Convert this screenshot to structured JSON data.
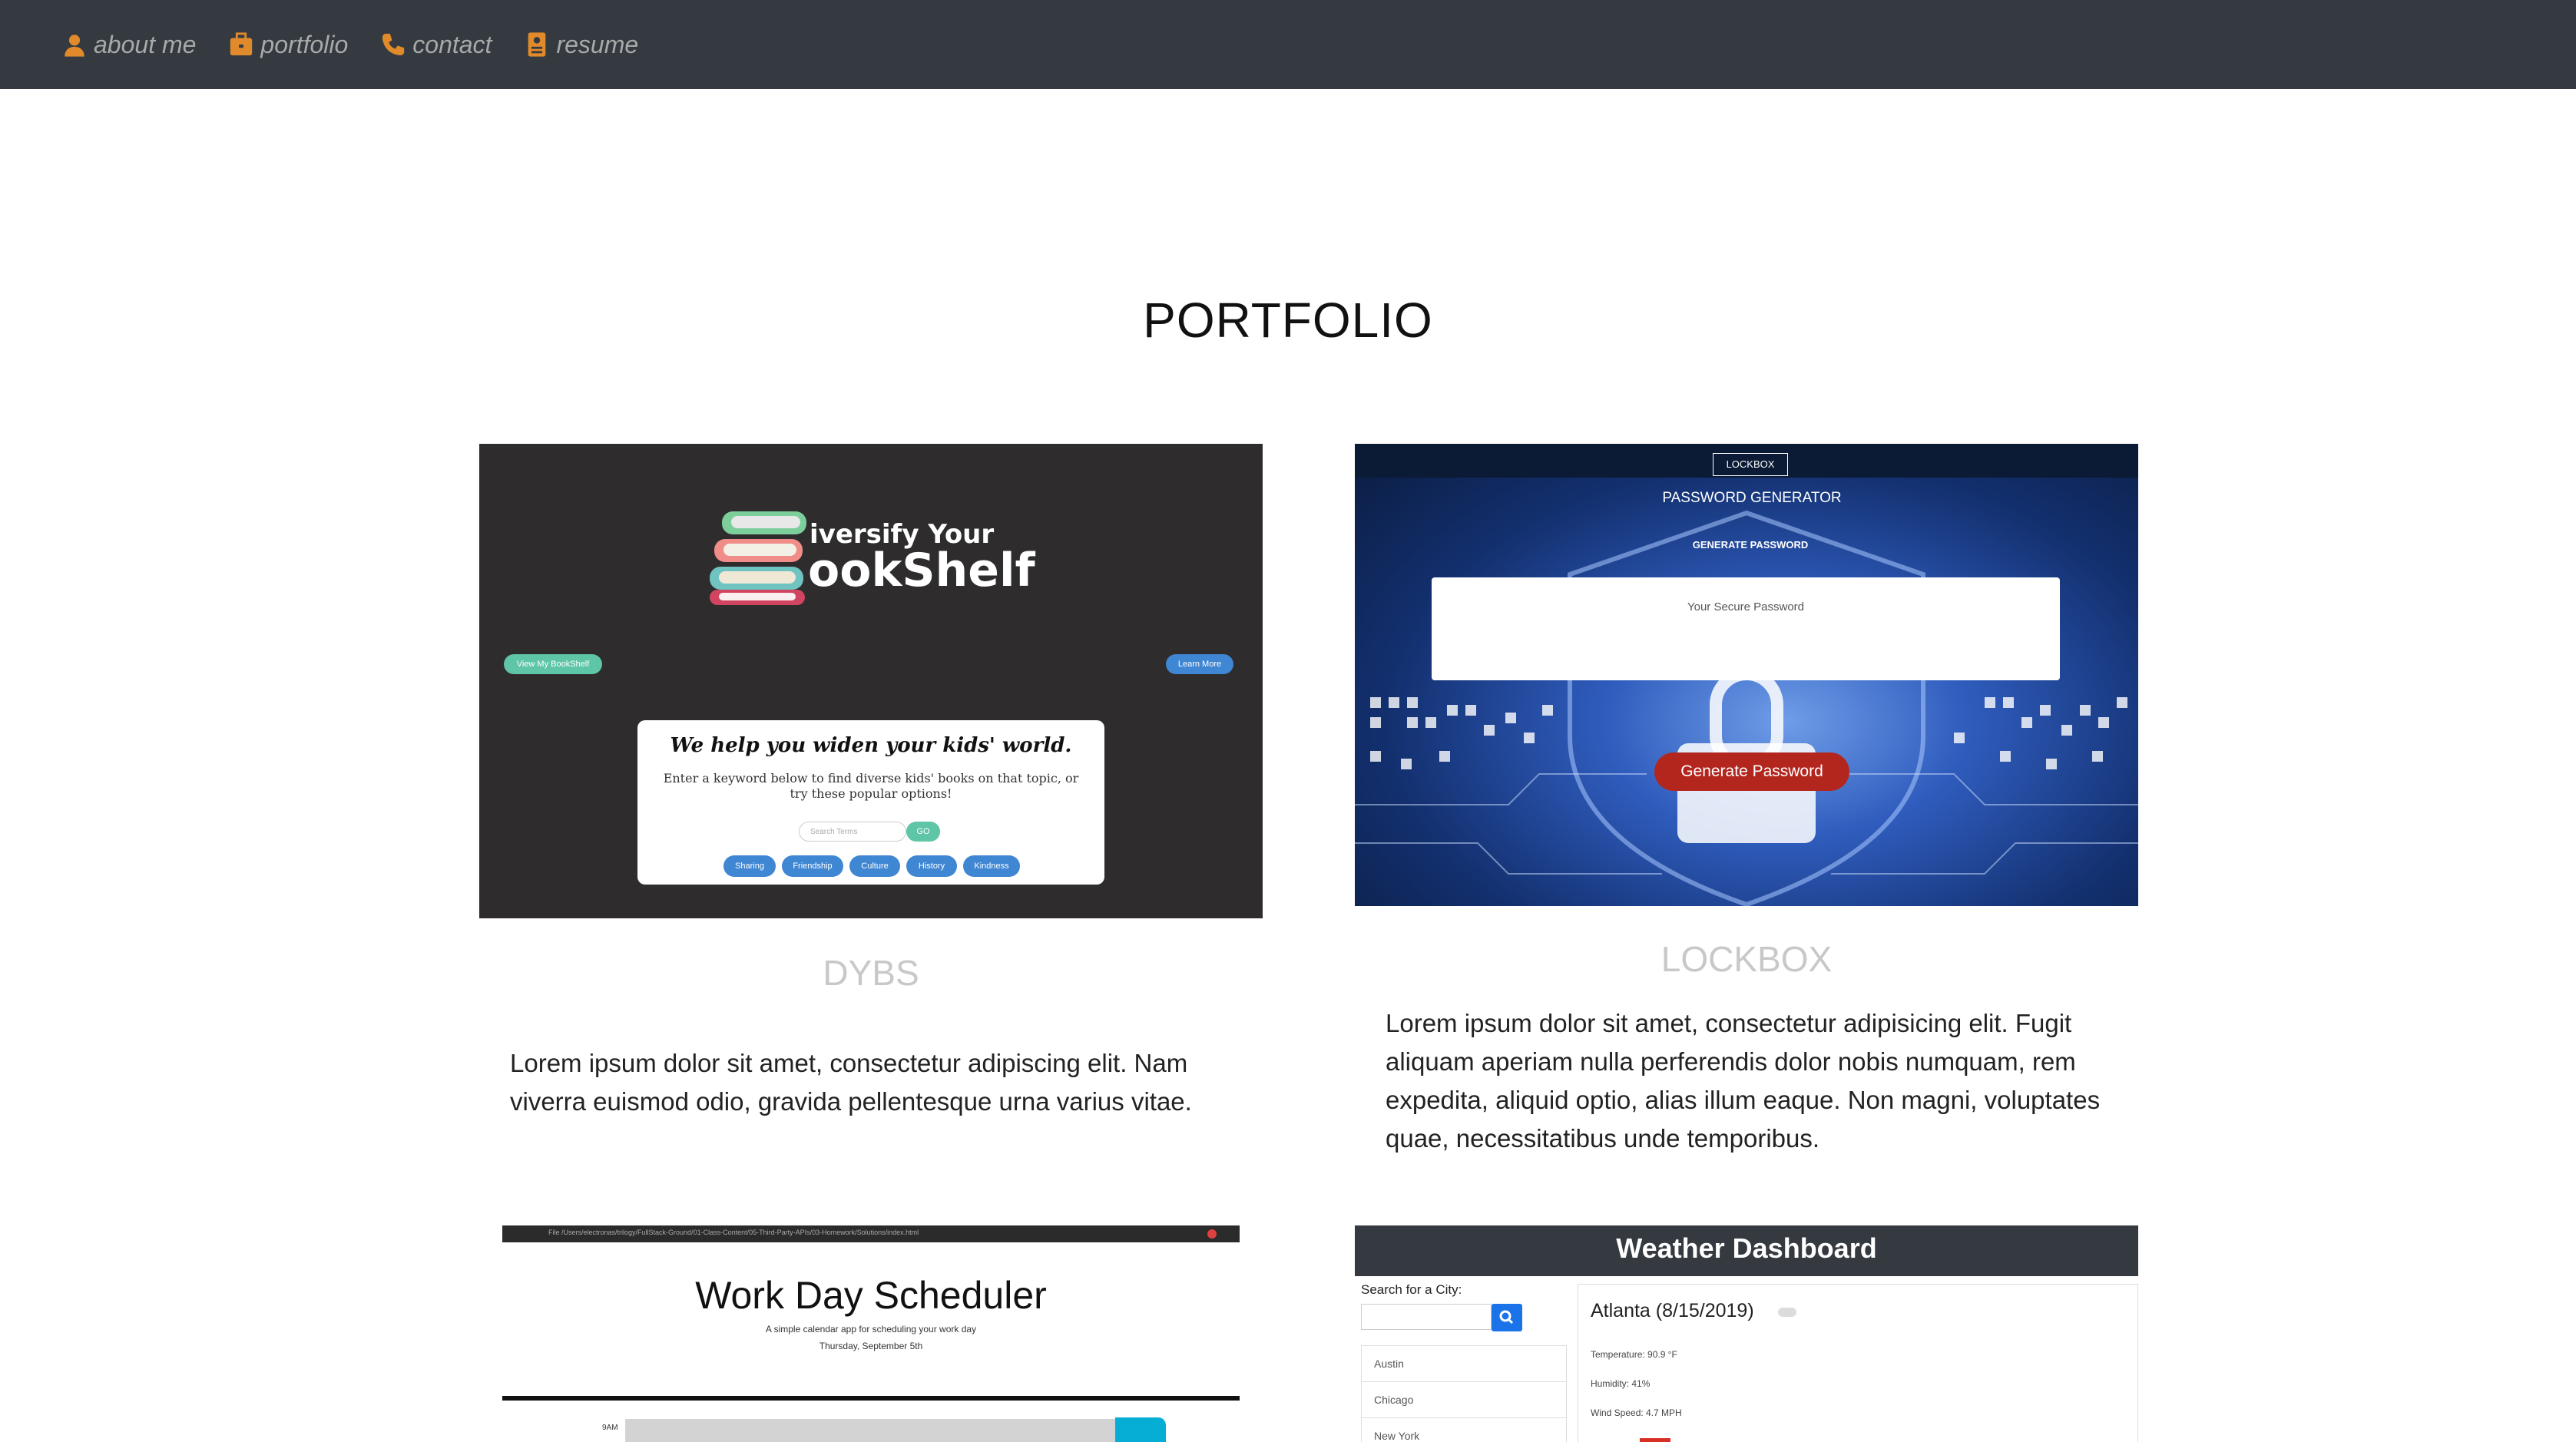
{
  "nav": {
    "items": [
      {
        "label": "about me",
        "icon": "user-icon"
      },
      {
        "label": "portfolio",
        "icon": "briefcase-icon"
      },
      {
        "label": "contact",
        "icon": "phone-icon"
      },
      {
        "label": "resume",
        "icon": "document-icon"
      }
    ],
    "text_color": "#a9a9a9",
    "icon_color": "#e08a2b",
    "bg_color": "#343a40"
  },
  "page_title": "PORTFOLIO",
  "projects": [
    {
      "title": "DYBS",
      "description": "Lorem ipsum dolor sit amet, consectetur adipiscing elit. Nam viverra euismod odio, gravida pellentesque urna varius vitae.",
      "thumb": {
        "logo_line1": "iversify Your",
        "logo_line2": "ookShelf",
        "left_button": "View My BookShelf",
        "right_button": "Learn More",
        "card_title": "We help you widen your kids' world.",
        "card_text": "Enter a keyword below to find diverse kids' books on that topic, or try these popular options!",
        "search_placeholder": "Search Terms",
        "go_label": "GO",
        "tags": [
          "Sharing",
          "Friendship",
          "Culture",
          "History",
          "Kindness"
        ]
      }
    },
    {
      "title": "LOCKBOX",
      "description": "Lorem ipsum dolor sit amet, consectetur adipisicing elit. Fugit aliquam aperiam nulla perferendis dolor nobis numquam, rem expedita, aliquid optio, alias illum eaque. Non magni, voluptates quae, necessitatibus unde temporibus.",
      "thumb": {
        "brand": "LOCKBOX",
        "heading": "PASSWORD GENERATOR",
        "subheading": "GENERATE PASSWORD",
        "output_placeholder": "Your Secure Password",
        "button": "Generate Password"
      }
    },
    {
      "thumb": {
        "url": "File  /Users/electronas/trilogy/FullStack-Ground/01-Class-Content/05-Third-Party-APIs/03-Homework/Solutions/index.html",
        "title": "Work Day Scheduler",
        "subtitle": "A simple calendar app for scheduling your work day",
        "date": "Thursday, September 5th",
        "hour": "9AM"
      }
    },
    {
      "thumb": {
        "header": "Weather Dashboard",
        "search_label": "Search for a City:",
        "cities": [
          "Austin",
          "Chicago",
          "New York"
        ],
        "current_city": "Atlanta (8/15/2019)",
        "temperature": "Temperature: 90.9 °F",
        "humidity": "Humidity: 41%",
        "wind": "Wind Speed: 4.7 MPH"
      }
    }
  ]
}
